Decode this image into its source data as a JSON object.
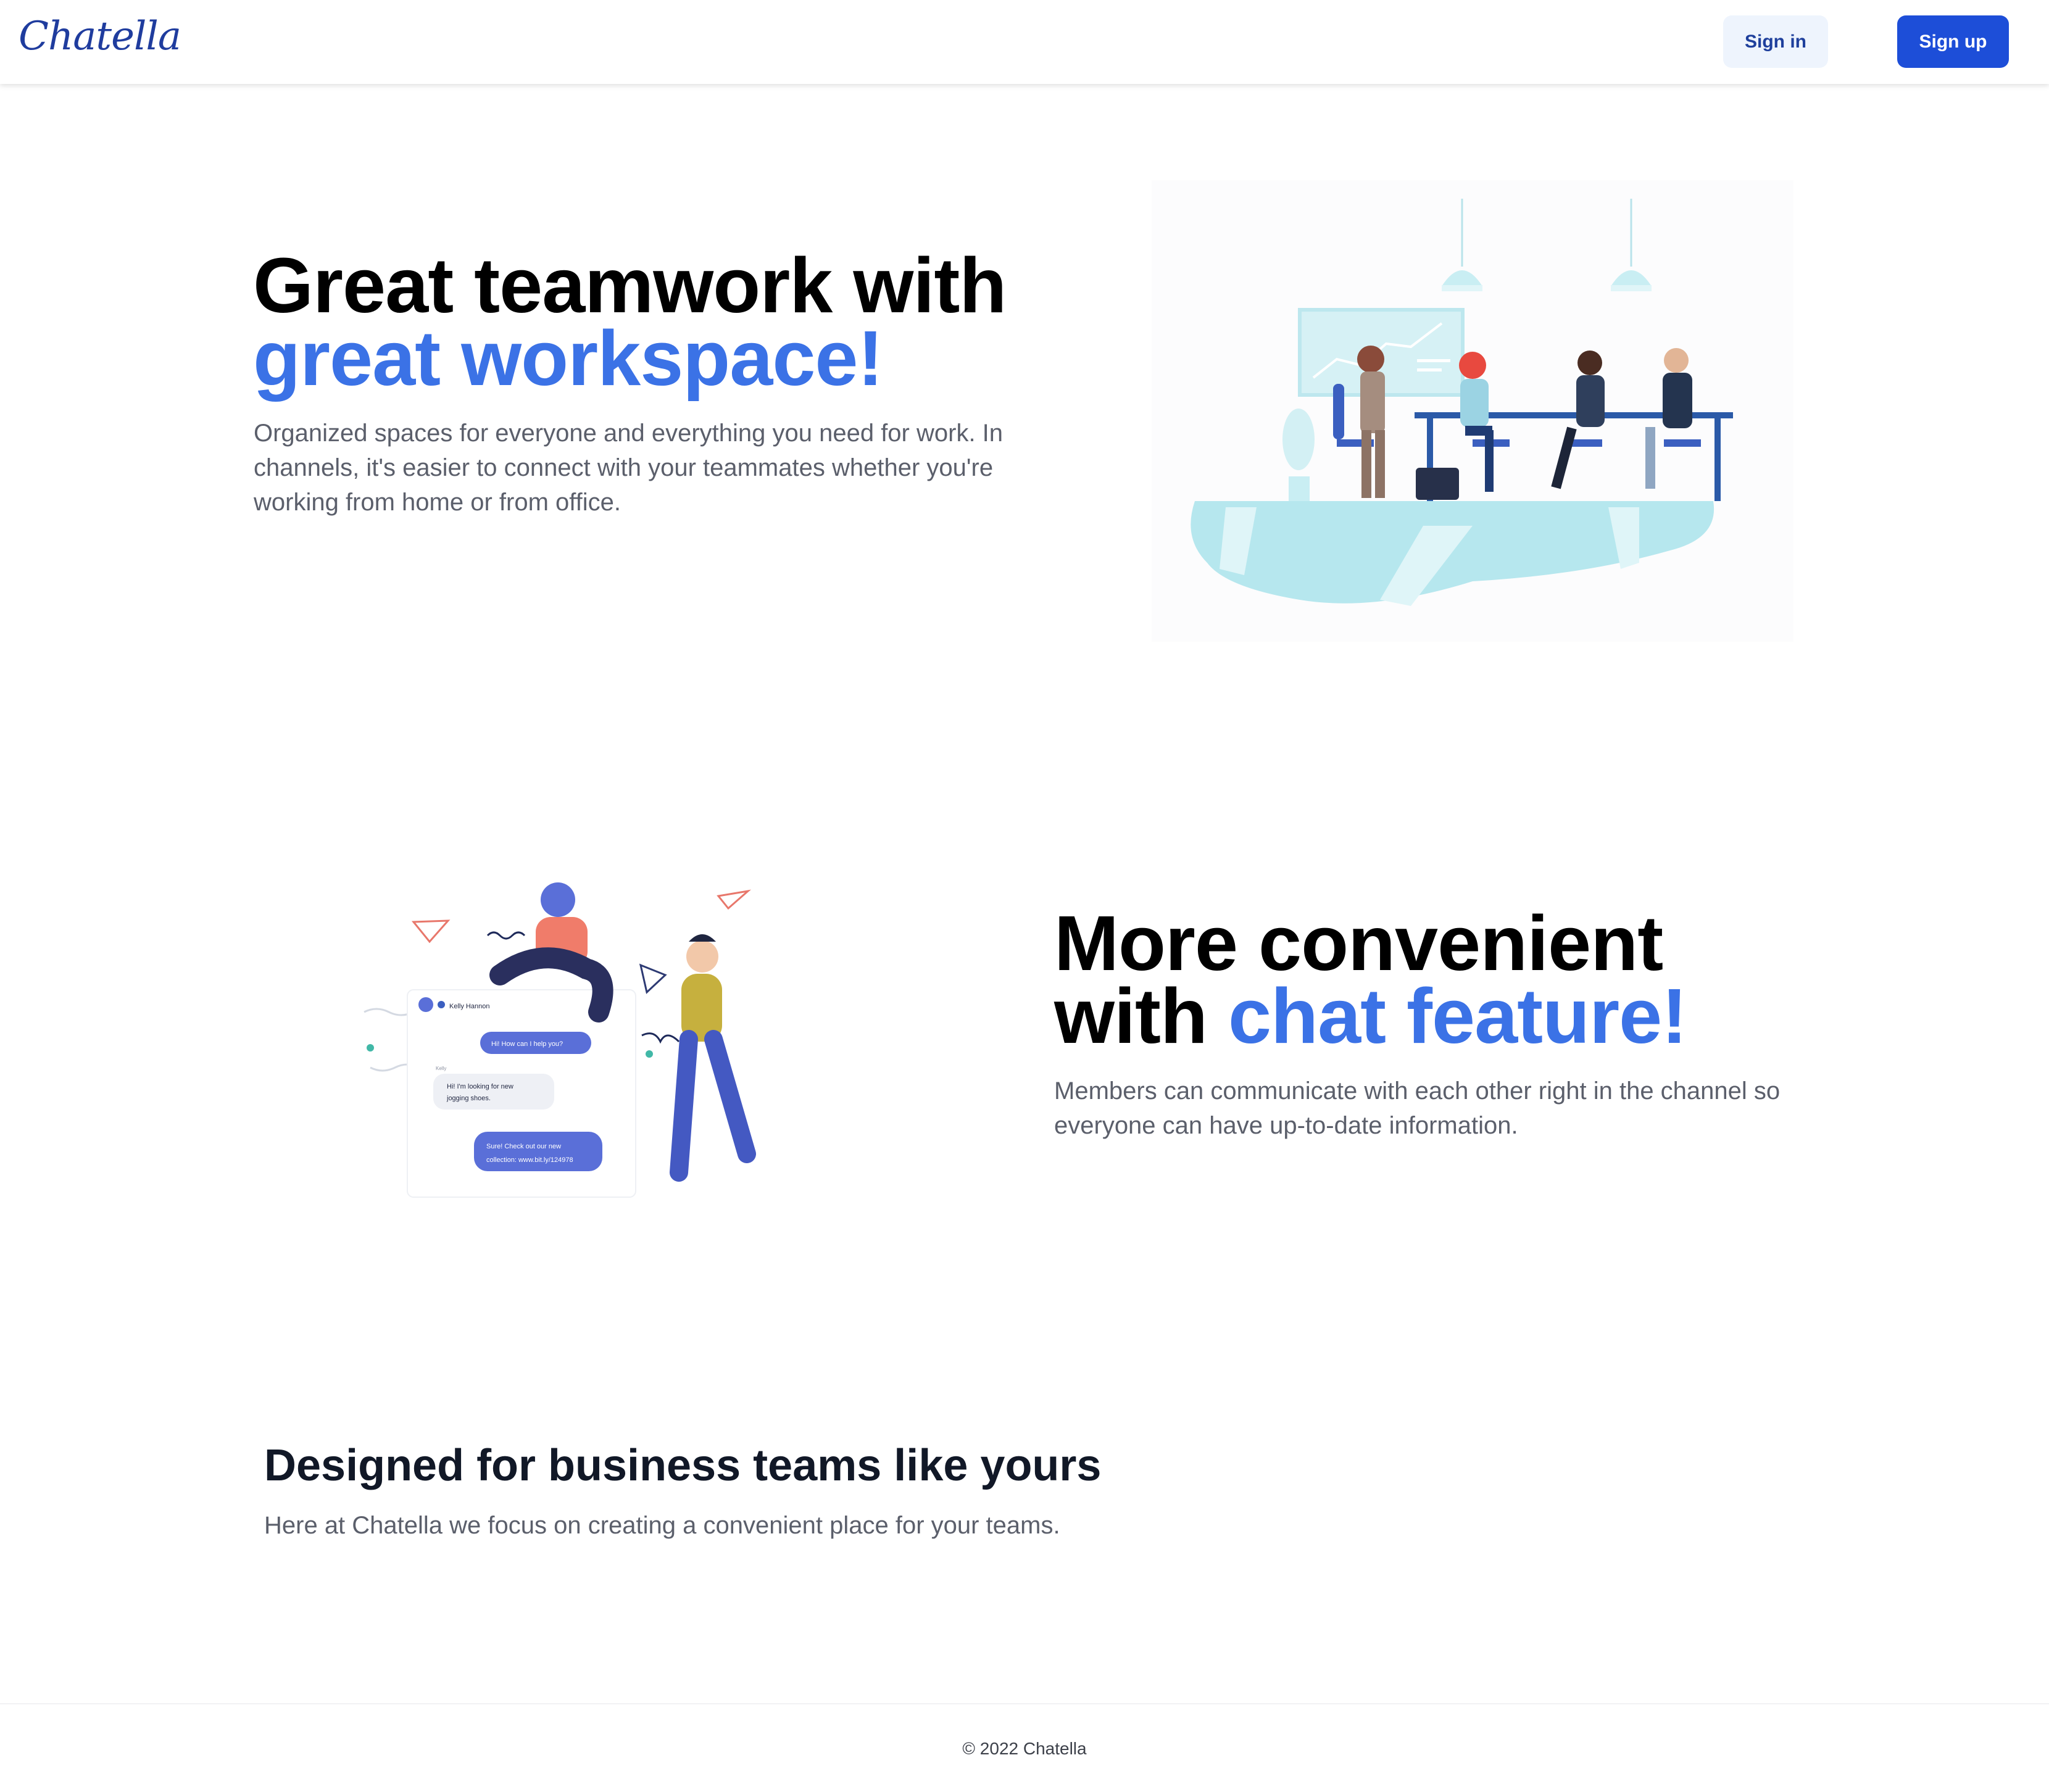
{
  "header": {
    "logo": "Chatella",
    "signin_label": "Sign in",
    "signup_label": "Sign up"
  },
  "hero": {
    "title_line1": "Great teamwork with",
    "title_line2": "great workspace!",
    "description": "Organized spaces for everyone and everything you need for work. In channels, it's easier to connect with your teammates whether you're working from home or from office."
  },
  "chat_section": {
    "title_line1": "More convenient",
    "title_line2_plain": "with ",
    "title_line2_accent": "chat feature!",
    "description": "Members can communicate with each other right in the channel so everyone can have up-to-date information.",
    "illustration": {
      "contact_name": "Kelly Hannon",
      "msg1": "Hi! How can I help you?",
      "sender_label": "Kelly",
      "msg2_line1": "Hi! I'm looking for new",
      "msg2_line2": "jogging shoes.",
      "msg3_line1": "Sure! Check out our new",
      "msg3_line2": "collection: www.bit.ly/124978"
    }
  },
  "business": {
    "title": "Designed for business teams like yours",
    "subtitle": "Here at Chatella we focus on creating a convenient place for your teams."
  },
  "footer": {
    "copyright": "© 2022 Chatella"
  },
  "colors": {
    "brand_blue": "#1d4ed8",
    "accent_blue": "#3b72e6",
    "signin_bg": "#eef4fd"
  }
}
